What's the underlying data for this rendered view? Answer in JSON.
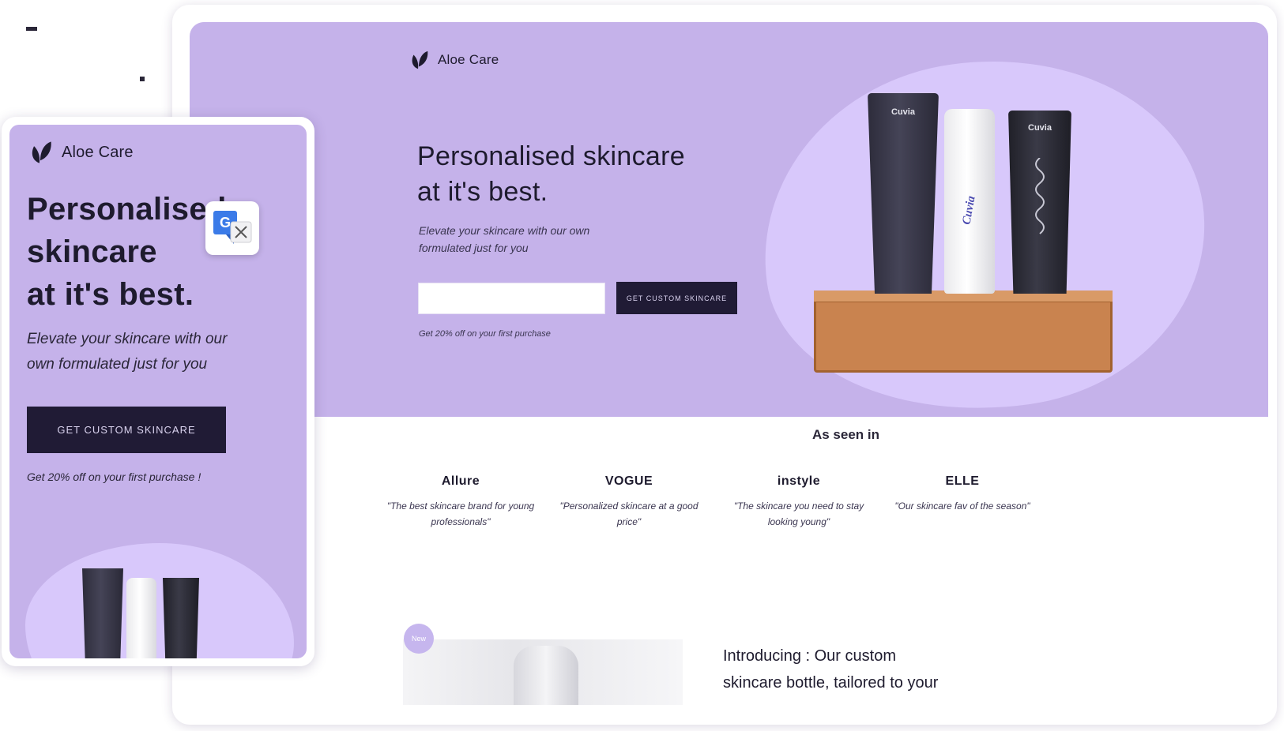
{
  "brand": {
    "name": "Aloe Care"
  },
  "desktop": {
    "hero": {
      "title_line1": "Personalised skincare",
      "title_line2": "at it's best.",
      "subtitle": "Elevate your skincare with our own formulated just for you",
      "email_placeholder": "",
      "cta_label": "Get custom skincare",
      "note": "Get 20% off on your first purchase"
    },
    "seen": {
      "title": "As seen in",
      "outlets": [
        {
          "name": "Allure",
          "quote": "\"The best skincare brand for young professionals\""
        },
        {
          "name": "VOGUE",
          "quote": "\"Personalized skincare at a good price\""
        },
        {
          "name": "instyle",
          "quote": "\"The skincare you need to stay looking young\""
        },
        {
          "name": "ELLE",
          "quote": "\"Our skincare fav of the season\""
        }
      ]
    },
    "intro": {
      "badge": "New",
      "text_line1": "Introducing : Our custom",
      "text_line2": "skincare bottle, tailored to your"
    },
    "product_labels": {
      "left": "Cuvia",
      "middle": "Cuvia",
      "right": "Cuvia"
    }
  },
  "mobile": {
    "title_line1": "Personalised",
    "title_line2": "skincare",
    "title_line3": "at it's best.",
    "subtitle_line1": "Elevate your skincare with our",
    "subtitle_line2": "own formulated just for you",
    "cta_label": "Get custom skincare",
    "note": "Get 20% off on your first purchase !"
  },
  "colors": {
    "hero_bg": "#c5b2ea",
    "blob": "#d8c8fb",
    "cta_bg": "#201b35",
    "text": "#1e1b2e"
  },
  "icons": {
    "logo": "leaf-icon",
    "translate": "translate-icon"
  }
}
